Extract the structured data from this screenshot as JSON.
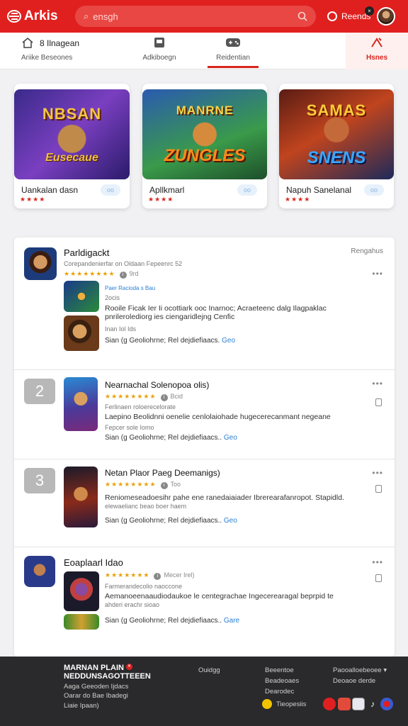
{
  "header": {
    "logo_text": "Arkis",
    "search_placeholder": "ensgh",
    "username": "Reends",
    "notification_count": "×",
    "brand_color": "#e0201f"
  },
  "tabs": [
    {
      "icon": "home-icon",
      "top": "8 Ilnagean",
      "bottom": "Ariike   Beseones"
    },
    {
      "icon": "app-icon",
      "bottom": "Adkiboegn"
    },
    {
      "icon": "controller-icon",
      "bottom": "Reidentian",
      "active": true
    },
    {
      "icon": "fire-icon",
      "bottom": "Hsnes",
      "hot": true
    }
  ],
  "featured": [
    {
      "art_top": "NBSAN",
      "art_bottom": "Eusecaue",
      "title": "Uankalan dasn",
      "stars": "★★★★",
      "badge": "oo"
    },
    {
      "art_top": "MANRNE",
      "art_bottom": "ZUNGLES",
      "title": "Apllkmarl",
      "stars": "★★★★",
      "badge": "oo"
    },
    {
      "art_top": "SAMAS",
      "art_bottom": "SNENS",
      "title": "Napuh Sanelanal",
      "stars": "★★★★",
      "badge": "oo"
    }
  ],
  "list": {
    "rank_label": "Rengahus",
    "rows": [
      {
        "title": "Parldigackt",
        "subtitle": "Corepandenierfar on Oldaan Fepeenrc 52",
        "stars": "★★★★★★★★",
        "rating_count": "9rd",
        "thumb1_caption": "Paer Racioda s  Bau",
        "thumb1_sub": "2ocis",
        "desc1": "Rooile Ficak Ier Ii ocottiark ooc Inarnoc; Acraeteenc dalg Ilagpaklac",
        "desc2": "pnrilerolediorg ies ciengaridlejng Cenfic",
        "thumb2_sub": "Inan Iol Ids",
        "meta": "Sian  (g  Geoliohrne; Rel dejdiefiaacs.",
        "meta_link": "Geo"
      },
      {
        "rank": "2",
        "title": "Nearnachal Solenopoa olis)",
        "stars": "★★★★★★★★",
        "rating_count": "Bcid",
        "subtitle": "Ferlinaen roloerecelorate",
        "desc1": "Laepino Beolidnni oenelie cenlolaiohade hugecerecanmant negeane",
        "desc2": "Fepcer sole  Iomo",
        "meta": "Sian  (g  Geoliohrne; Rel dejdiefiaacs..",
        "meta_link": "Geo"
      },
      {
        "rank": "3",
        "title": "Netan Plaor Paeg Deemanigs)",
        "stars": "★★★★★★★★",
        "rating_count": "Too",
        "subtitle": "",
        "desc1": "Reniomeseadoesihr pahe ene ranedaiaiader Ibrerearafanropot. Stapidld.",
        "desc2": "elewaelianc beao boer haem",
        "meta": "Sian  (g  Geoliohrne; Rel dejdiefiaacs..",
        "meta_link": "Geo"
      },
      {
        "title": "Eoaplaarl Idao",
        "stars": "★★★★★★★",
        "rating_count": "Mecer Irel)",
        "subtitle": "Farmerandecolio naoccone",
        "desc1": "Aemanoeenaaudiodaukoe le centegrachae Ingecerearagal beprpid te",
        "desc2": "ahderi erachr sioao",
        "meta": "Sian  (g  Geoliohrne; Rel dejdiefiaacs..",
        "meta_link": "Gare"
      }
    ]
  },
  "footer": {
    "brand_line1": "MARNAN PLAIN",
    "brand_line2": "NEDDUNSAGOTTEEEN",
    "brand_badge": "×",
    "brand_sub1": "Aaga Geeoden Ijdacs",
    "brand_sub2": "Oarar do Bae Ibadegi",
    "brand_sub3": "Liaie Ipaan)",
    "col2": "Ouidgg",
    "col3": [
      "Beeentoe",
      "Beadeoaes",
      "Dearodec"
    ],
    "col4": [
      "Paooalloebeoee",
      "Deoaoe derde"
    ],
    "chat_label": "Tieopesiis"
  }
}
